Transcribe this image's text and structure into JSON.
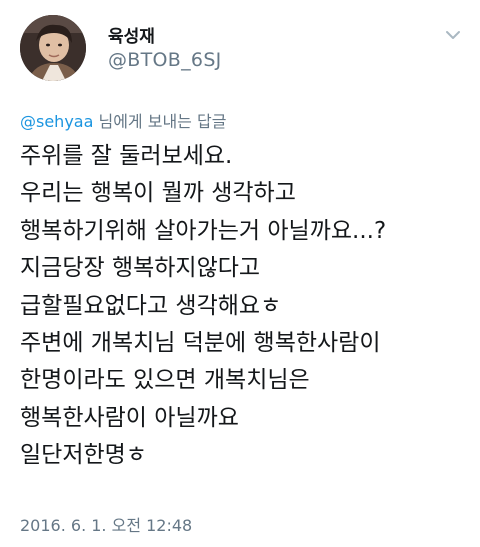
{
  "user": {
    "display_name": "육성재",
    "handle": "@BTOB_6SJ"
  },
  "reply_context": {
    "mention": "@sehyaa",
    "suffix": " 님에게 보내는 답글"
  },
  "tweet": {
    "lines": [
      "주위를 잘 둘러보세요.",
      "우리는 행복이 뭘까 생각하고",
      "행복하기위해 살아가는거 아닐까요...?",
      "지금당장 행복하지않다고",
      "급할필요없다고 생각해요ㅎ",
      "주변에 개복치님 덕분에 행복한사람이",
      "한명이라도 있으면 개복치님은",
      "행복한사람이 아닐까요",
      "일단저한명ㅎ"
    ],
    "timestamp": "2016. 6. 1. 오전 12:48"
  },
  "icons": {
    "avatar": "profile-photo",
    "menu": "chevron-down-icon"
  },
  "colors": {
    "text": "#14171a",
    "secondary": "#657786",
    "link": "#1b95e0"
  }
}
